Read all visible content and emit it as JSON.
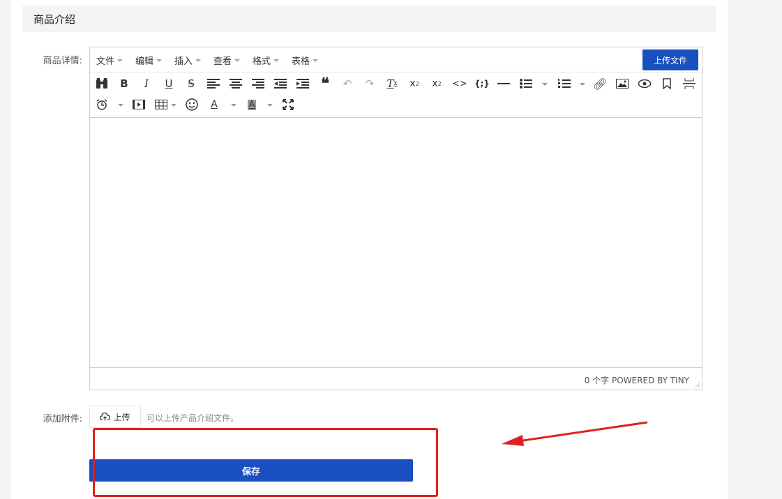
{
  "section": {
    "title": "商品介绍"
  },
  "form": {
    "detail_label": "商品详情:",
    "attachment_label": "添加附件:",
    "upload_label": "上传",
    "upload_hint": "可以上传产品介绍文件。",
    "save_label": "保存"
  },
  "editor": {
    "menus": [
      "文件",
      "编辑",
      "插入",
      "查看",
      "格式",
      "表格"
    ],
    "upload_file_label": "上传文件",
    "status": "0 个字 POWERED BY TINY",
    "toolbar_row1": [
      "find-replace-icon",
      "bold-icon",
      "italic-icon",
      "underline-icon",
      "strikethrough-icon",
      "align-left-icon",
      "align-center-icon",
      "align-right-icon",
      "outdent-icon",
      "indent-icon",
      "blockquote-icon",
      "undo-icon",
      "redo-icon",
      "clear-format-icon",
      "subscript-icon",
      "superscript-icon",
      "code-icon",
      "code-sample-icon",
      "horizontal-rule-icon",
      "bullet-list-icon",
      "numbered-list-icon",
      "link-icon",
      "image-icon",
      "preview-icon",
      "bookmark-icon",
      "page-break-icon"
    ],
    "toolbar_row2": [
      "datetime-icon",
      "media-icon",
      "table-icon",
      "emoticon-icon",
      "text-color-icon",
      "background-color-icon",
      "fullscreen-icon"
    ]
  },
  "colors": {
    "primary": "#1a4fbf",
    "annotation": "#e02020"
  }
}
